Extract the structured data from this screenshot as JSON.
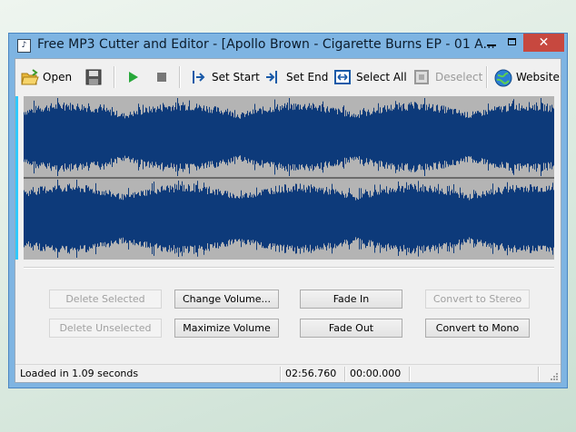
{
  "window": {
    "title": "Free MP3 Cutter and Editor - [Apollo Brown - Cigarette Burns EP - 01 A...",
    "controls": {
      "minimize": "–",
      "maximize": "□",
      "close": "✕"
    }
  },
  "toolbar": {
    "open": "Open",
    "save_icon": "floppy-disk-icon",
    "play_icon": "play-icon",
    "stop_icon": "stop-icon",
    "set_start": "Set Start",
    "set_end": "Set End",
    "select_all": "Select All",
    "deselect": "Deselect",
    "website": "Website"
  },
  "waveform": {
    "background": "#b4b4b4",
    "wave_color": "#0d3a7a",
    "channels": 2
  },
  "buttons": {
    "delete_selected": "Delete Selected",
    "change_volume": "Change Volume...",
    "fade_in": "Fade In",
    "convert_to_stereo": "Convert to Stereo",
    "delete_unselected": "Delete Unselected",
    "maximize_volume": "Maximize Volume",
    "fade_out": "Fade Out",
    "convert_to_mono": "Convert to Mono"
  },
  "status": {
    "message": "Loaded in 1.09 seconds",
    "duration": "02:56.760",
    "position": "00:00.000"
  },
  "colors": {
    "titlebar": "#7eb4e2",
    "close_button": "#c7483f",
    "accent": "#30c8ff"
  }
}
